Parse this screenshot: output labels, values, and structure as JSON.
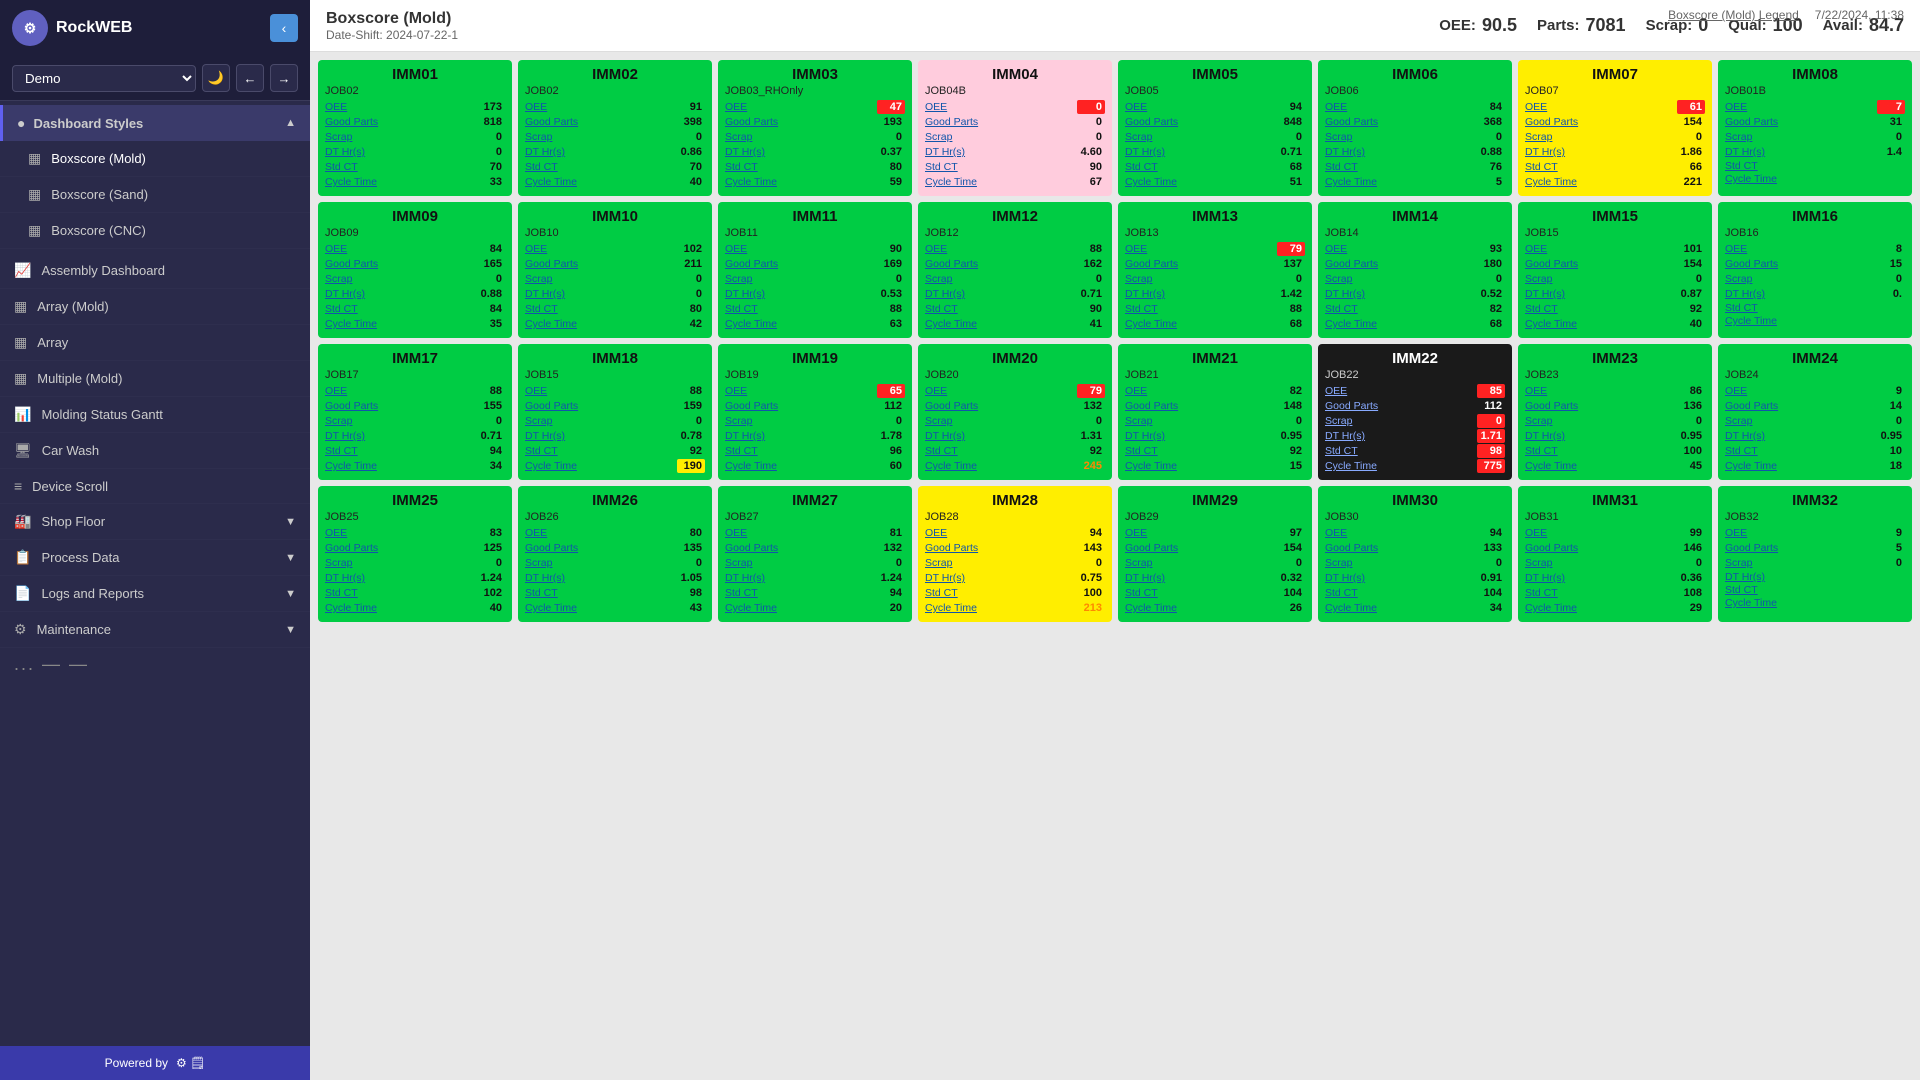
{
  "app": {
    "title": "RockWEB",
    "demo_label": "Demo"
  },
  "topbar": {
    "legend_link": "Boxscore (Mold) Legend",
    "datetime": "7/22/2024, 11:38",
    "title": "Boxscore (Mold)",
    "date_shift": "Date-Shift: 2024-07-22-1",
    "oee_label": "OEE:",
    "oee_value": "90.5",
    "parts_label": "Parts:",
    "parts_value": "7081",
    "scrap_label": "Scrap:",
    "scrap_value": "0",
    "qual_label": "Qual:",
    "qual_value": "100",
    "avail_label": "Avail:",
    "avail_value": "84.7"
  },
  "sidebar": {
    "nav_groups": [
      {
        "label": "Dashboard Styles",
        "items": [
          {
            "label": "Boxscore (Mold)",
            "icon": "▦"
          },
          {
            "label": "Boxscore (Sand)",
            "icon": "▦"
          },
          {
            "label": "Boxscore (CNC)",
            "icon": "▦"
          }
        ]
      }
    ],
    "nav_items": [
      {
        "label": "Assembly Dashboard",
        "icon": "📈"
      },
      {
        "label": "Array (Mold)",
        "icon": "▦"
      },
      {
        "label": "Array",
        "icon": "▦"
      },
      {
        "label": "Multiple (Mold)",
        "icon": "▦"
      },
      {
        "label": "Molding Status Gantt",
        "icon": "📊"
      },
      {
        "label": "Car Wash",
        "icon": "🖥"
      },
      {
        "label": "Device Scroll",
        "icon": "≡"
      }
    ],
    "nav_groups2": [
      {
        "label": "Shop Floor"
      },
      {
        "label": "Process Data"
      },
      {
        "label": "Logs and Reports"
      },
      {
        "label": "Maintenance"
      }
    ],
    "powered_by": "Powered by"
  },
  "machines": [
    {
      "id": "IMM01",
      "job": "JOB02",
      "oee": "173",
      "oee_flag": "",
      "good_parts": "818",
      "scrap": "0",
      "dt_hrs": "0",
      "std_ct": "70",
      "cycle_time": "33",
      "color": "green"
    },
    {
      "id": "IMM02",
      "job": "JOB02",
      "oee": "91",
      "oee_flag": "",
      "good_parts": "398",
      "scrap": "0",
      "dt_hrs": "0.86",
      "std_ct": "70",
      "cycle_time": "40",
      "color": "green"
    },
    {
      "id": "IMM03",
      "job": "JOB03_RHOnly",
      "oee": "47",
      "oee_flag": "red",
      "good_parts": "193",
      "scrap": "0",
      "dt_hrs": "0.37",
      "std_ct": "80",
      "cycle_time": "59",
      "color": "green"
    },
    {
      "id": "IMM04",
      "job": "JOB04B",
      "oee": "0",
      "oee_flag": "red",
      "good_parts": "0",
      "scrap": "0",
      "dt_hrs": "4.60",
      "std_ct": "90",
      "cycle_time": "67",
      "color": "pink"
    },
    {
      "id": "IMM05",
      "job": "JOB05",
      "oee": "94",
      "oee_flag": "",
      "good_parts": "848",
      "scrap": "0",
      "dt_hrs": "0.71",
      "std_ct": "68",
      "cycle_time": "51",
      "color": "green"
    },
    {
      "id": "IMM06",
      "job": "JOB06",
      "oee": "84",
      "oee_flag": "",
      "good_parts": "368",
      "scrap": "0",
      "dt_hrs": "0.88",
      "std_ct": "76",
      "cycle_time": "5",
      "color": "green"
    },
    {
      "id": "IMM07",
      "job": "JOB07",
      "oee": "61",
      "oee_flag": "red",
      "good_parts": "154",
      "scrap": "0",
      "dt_hrs": "1.86",
      "std_ct": "66",
      "cycle_time": "221",
      "cycle_time_flag": "yellow",
      "color": "yellow"
    },
    {
      "id": "IMM08",
      "job": "JOB01B",
      "oee": "7",
      "oee_flag": "red",
      "good_parts": "31",
      "scrap": "0",
      "dt_hrs": "1.4",
      "std_ct": "",
      "cycle_time": "",
      "color": "green"
    },
    {
      "id": "IMM09",
      "job": "JOB09",
      "oee": "84",
      "oee_flag": "",
      "good_parts": "165",
      "scrap": "0",
      "dt_hrs": "0.88",
      "std_ct": "84",
      "cycle_time": "35",
      "color": "green"
    },
    {
      "id": "IMM10",
      "job": "JOB10",
      "oee": "102",
      "oee_flag": "",
      "good_parts": "211",
      "scrap": "0",
      "dt_hrs": "0",
      "std_ct": "80",
      "cycle_time": "42",
      "color": "green"
    },
    {
      "id": "IMM11",
      "job": "JOB11",
      "oee": "90",
      "oee_flag": "",
      "good_parts": "169",
      "scrap": "0",
      "dt_hrs": "0.53",
      "std_ct": "88",
      "cycle_time": "63",
      "color": "green"
    },
    {
      "id": "IMM12",
      "job": "JOB12",
      "oee": "88",
      "oee_flag": "",
      "good_parts": "162",
      "scrap": "0",
      "dt_hrs": "0.71",
      "std_ct": "90",
      "cycle_time": "41",
      "color": "green"
    },
    {
      "id": "IMM13",
      "job": "JOB13",
      "oee": "79",
      "oee_flag": "red",
      "good_parts": "137",
      "scrap": "0",
      "dt_hrs": "1.42",
      "std_ct": "88",
      "cycle_time": "68",
      "color": "green"
    },
    {
      "id": "IMM14",
      "job": "JOB14",
      "oee": "93",
      "oee_flag": "",
      "good_parts": "180",
      "scrap": "0",
      "dt_hrs": "0.52",
      "std_ct": "82",
      "cycle_time": "68",
      "color": "green"
    },
    {
      "id": "IMM15",
      "job": "JOB15",
      "oee": "101",
      "oee_flag": "",
      "good_parts": "154",
      "scrap": "0",
      "dt_hrs": "0.87",
      "std_ct": "92",
      "cycle_time": "40",
      "color": "green"
    },
    {
      "id": "IMM16",
      "job": "JOB16",
      "oee": "8",
      "oee_flag": "",
      "good_parts": "15",
      "scrap": "0",
      "dt_hrs": "0.",
      "std_ct": "",
      "cycle_time": "",
      "color": "green"
    },
    {
      "id": "IMM17",
      "job": "JOB17",
      "oee": "88",
      "oee_flag": "",
      "good_parts": "155",
      "scrap": "0",
      "dt_hrs": "0.71",
      "std_ct": "94",
      "cycle_time": "34",
      "color": "green"
    },
    {
      "id": "IMM18",
      "job": "JOB15",
      "oee": "88",
      "oee_flag": "",
      "good_parts": "159",
      "scrap": "0",
      "dt_hrs": "0.78",
      "std_ct": "92",
      "cycle_time": "190",
      "cycle_time_flag": "yellow",
      "color": "green"
    },
    {
      "id": "IMM19",
      "job": "JOB19",
      "oee": "65",
      "oee_flag": "red",
      "good_parts": "112",
      "scrap": "0",
      "dt_hrs": "1.78",
      "std_ct": "96",
      "cycle_time": "60",
      "color": "green"
    },
    {
      "id": "IMM20",
      "job": "JOB20",
      "oee": "79",
      "oee_flag": "red",
      "good_parts": "132",
      "scrap": "0",
      "dt_hrs": "1.31",
      "std_ct": "92",
      "cycle_time": "245",
      "cycle_time_flag": "orange",
      "color": "green"
    },
    {
      "id": "IMM21",
      "job": "JOB21",
      "oee": "82",
      "oee_flag": "",
      "good_parts": "148",
      "scrap": "0",
      "dt_hrs": "0.95",
      "std_ct": "92",
      "cycle_time": "15",
      "color": "green"
    },
    {
      "id": "IMM22",
      "job": "JOB22",
      "oee": "85",
      "oee_flag": "red",
      "good_parts": "112",
      "scrap": "0",
      "dt_hrs": "1.71",
      "std_ct": "98",
      "cycle_time": "775",
      "cycle_time_flag": "red",
      "color": "dark"
    },
    {
      "id": "IMM23",
      "job": "JOB23",
      "oee": "86",
      "oee_flag": "",
      "good_parts": "136",
      "scrap": "0",
      "dt_hrs": "0.95",
      "std_ct": "100",
      "cycle_time": "45",
      "color": "green"
    },
    {
      "id": "IMM24",
      "job": "JOB24",
      "oee": "9",
      "oee_flag": "",
      "good_parts": "14",
      "scrap": "0",
      "dt_hrs": "0.95",
      "std_ct": "10",
      "cycle_time": "18",
      "color": "green"
    },
    {
      "id": "IMM25",
      "job": "JOB25",
      "oee": "83",
      "oee_flag": "",
      "good_parts": "125",
      "scrap": "0",
      "dt_hrs": "1.24",
      "std_ct": "102",
      "cycle_time": "40",
      "color": "green"
    },
    {
      "id": "IMM26",
      "job": "JOB26",
      "oee": "80",
      "oee_flag": "",
      "good_parts": "135",
      "scrap": "0",
      "dt_hrs": "1.05",
      "std_ct": "98",
      "cycle_time": "43",
      "color": "green"
    },
    {
      "id": "IMM27",
      "job": "JOB27",
      "oee": "81",
      "oee_flag": "",
      "good_parts": "132",
      "scrap": "0",
      "dt_hrs": "1.24",
      "std_ct": "94",
      "cycle_time": "20",
      "color": "green"
    },
    {
      "id": "IMM28",
      "job": "JOB28",
      "oee": "94",
      "oee_flag": "",
      "good_parts": "143",
      "scrap": "0",
      "dt_hrs": "0.75",
      "std_ct": "100",
      "cycle_time": "213",
      "cycle_time_flag": "orange",
      "color": "yellow"
    },
    {
      "id": "IMM29",
      "job": "JOB29",
      "oee": "97",
      "oee_flag": "",
      "good_parts": "154",
      "scrap": "0",
      "dt_hrs": "0.32",
      "std_ct": "104",
      "cycle_time": "26",
      "color": "green"
    },
    {
      "id": "IMM30",
      "job": "JOB30",
      "oee": "94",
      "oee_flag": "",
      "good_parts": "133",
      "scrap": "0",
      "dt_hrs": "0.91",
      "std_ct": "104",
      "cycle_time": "34",
      "color": "green"
    },
    {
      "id": "IMM31",
      "job": "JOB31",
      "oee": "99",
      "oee_flag": "",
      "good_parts": "146",
      "scrap": "0",
      "dt_hrs": "0.36",
      "std_ct": "108",
      "cycle_time": "29",
      "color": "green"
    },
    {
      "id": "IMM32",
      "job": "JOB32",
      "oee": "9",
      "oee_flag": "",
      "good_parts": "5",
      "scrap": "0",
      "dt_hrs": "",
      "std_ct": "",
      "cycle_time": "",
      "color": "green"
    }
  ],
  "labels": {
    "oee": "OEE",
    "good_parts": "Good Parts",
    "scrap": "Scrap",
    "dt_hrs": "DT Hr(s)",
    "std_ct": "Std CT",
    "cycle_time": "Cycle Time"
  }
}
